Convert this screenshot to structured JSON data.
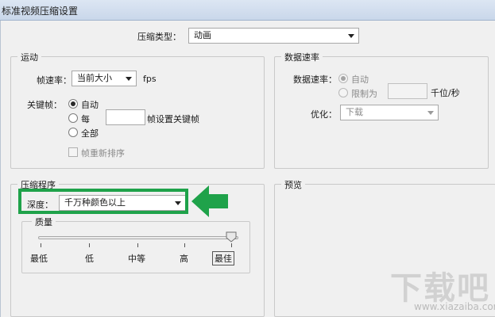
{
  "window": {
    "title": "标准视频压缩设置"
  },
  "compression_type": {
    "label": "压缩类型：",
    "value": "动画"
  },
  "motion": {
    "legend": "运动",
    "frame_rate_label": "帧速率：",
    "frame_rate_value": "当前大小",
    "frame_rate_unit": "fps",
    "keyframe_label": "关键帧：",
    "keyframe_auto": "自动",
    "keyframe_every": "每",
    "keyframe_every_suffix": "帧设置关键帧",
    "keyframe_all": "全部",
    "keyframe_selected": "auto",
    "frame_reorder": "帧重新排序"
  },
  "data_rate": {
    "legend": "数据速率",
    "label": "数据速率：",
    "auto": "自动",
    "limit": "限制为",
    "unit": "千位/秒",
    "optimize_label": "优化：",
    "optimize_value": "下载"
  },
  "compressor": {
    "legend": "压缩程序",
    "depth_label": "深度：",
    "depth_value": "千万种颜色以上",
    "quality_legend": "质量",
    "quality_levels": [
      "最低",
      "低",
      "中等",
      "高",
      "最佳"
    ],
    "quality_selected": "最佳"
  },
  "preview": {
    "legend": "预览"
  },
  "annotation": {
    "color": "#1fa24a"
  },
  "watermark": {
    "text": "下载吧",
    "sub": "www.xiazaiba.com"
  }
}
